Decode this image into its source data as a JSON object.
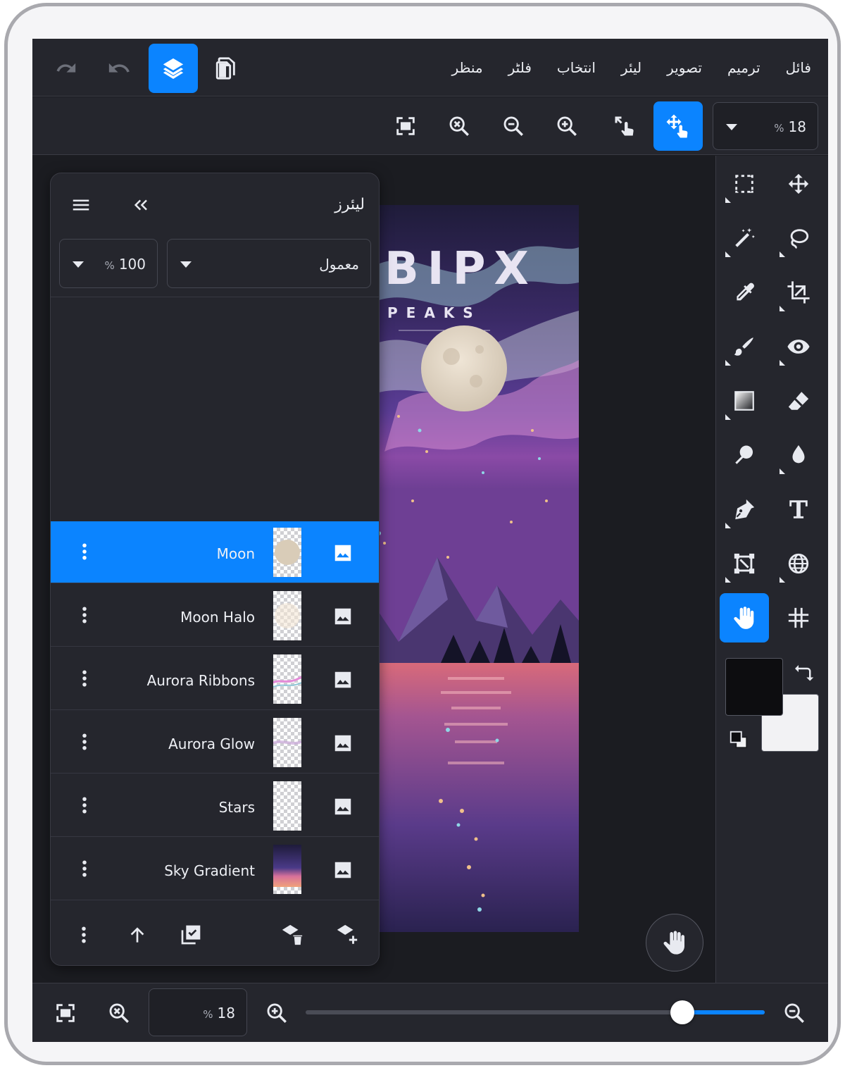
{
  "menubar": {
    "items": [
      "فائل",
      "ترمیم",
      "تصویر",
      "لیئر",
      "انتخاب",
      "فلٹر",
      "منظر"
    ]
  },
  "toolbar2": {
    "zoom_value": "18",
    "zoom_unit": "%"
  },
  "artwork": {
    "title_text": "BIPX",
    "subtitle_text": "PEAKS"
  },
  "layers_panel": {
    "title": "لیئرز",
    "blend_mode": "معمول",
    "opacity_value": "100",
    "opacity_unit": "%",
    "layers": [
      {
        "name": "Moon",
        "selected": true
      },
      {
        "name": "Moon Halo",
        "selected": false
      },
      {
        "name": "Aurora Ribbons",
        "selected": false
      },
      {
        "name": "Aurora Glow",
        "selected": false
      },
      {
        "name": "Stars",
        "selected": false
      },
      {
        "name": "Sky Gradient",
        "selected": false
      }
    ]
  },
  "bottombar": {
    "zoom_value": "18",
    "zoom_unit": "%",
    "slider_value": 0.82
  },
  "colors": {
    "accent": "#0b84ff",
    "foreground": "#0d0d10",
    "background": "#f2f2f4"
  },
  "icons": [
    "redo-icon",
    "undo-icon",
    "layers-icon",
    "pages-icon",
    "fit-screen-icon",
    "zoom-reset-icon",
    "zoom-out-icon",
    "zoom-in-icon",
    "transform-touch-icon",
    "move-touch-icon",
    "marquee-icon",
    "move-icon",
    "magic-wand-icon",
    "lasso-icon",
    "eyedropper-icon",
    "crop-icon",
    "brush-icon",
    "eye-icon",
    "gradient-icon",
    "eraser-icon",
    "smudge-icon",
    "blur-drop-icon",
    "pen-icon",
    "text-icon",
    "free-transform-icon",
    "globe-icon",
    "hand-icon",
    "grid-icon",
    "swap-colors-icon",
    "default-colors-icon"
  ]
}
